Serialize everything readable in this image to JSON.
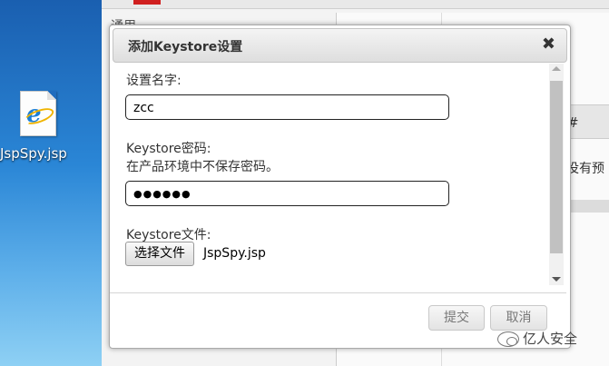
{
  "desktop": {
    "icon_label": "JspSpy.jsp",
    "icon": "ie-file-icon"
  },
  "background_app": {
    "tab_label": "通用",
    "table_header": "#",
    "empty_text": "没有预"
  },
  "dialog": {
    "title": "添加Keystore设置",
    "close_icon": "close-icon",
    "fields": {
      "name_label": "设置名字:",
      "name_value": "zcc",
      "password_label": "Keystore密码:",
      "password_note": "在产品环境中不保存密码。",
      "password_value": "●●●●●●",
      "file_label": "Keystore文件:",
      "file_button": "选择文件",
      "file_name": "JspSpy.jsp"
    },
    "buttons": {
      "submit": "提交",
      "cancel": "取消"
    }
  },
  "watermark": {
    "text": "亿人安全"
  }
}
